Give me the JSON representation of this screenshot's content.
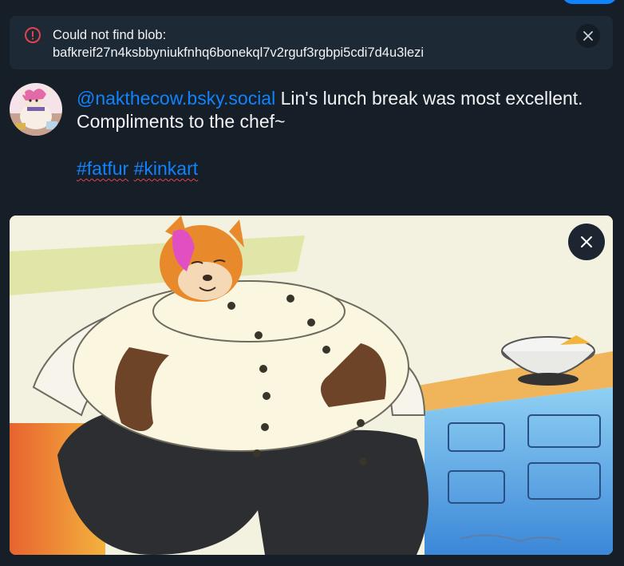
{
  "error": {
    "line1": "Could not find blob:",
    "line2": "bafkreif27n4ksbbyniukfnhq6bonekql7v2rguf3rgbpi5cdi7d4u3lezi",
    "icon": "alert-circle-icon",
    "close_icon": "close-icon"
  },
  "post": {
    "mention": "@nakthecow.bsky.social",
    "text_part1": " Lin's lunch break was most excellent.",
    "text_part2": "Compliments to the chef~",
    "tags": [
      "#fatfur",
      "#kinkart"
    ]
  },
  "image": {
    "close_icon": "close-icon"
  },
  "colors": {
    "background": "#161e27",
    "accent": "#1083fe",
    "error": "#e0434e",
    "banner": "#1e2936"
  }
}
